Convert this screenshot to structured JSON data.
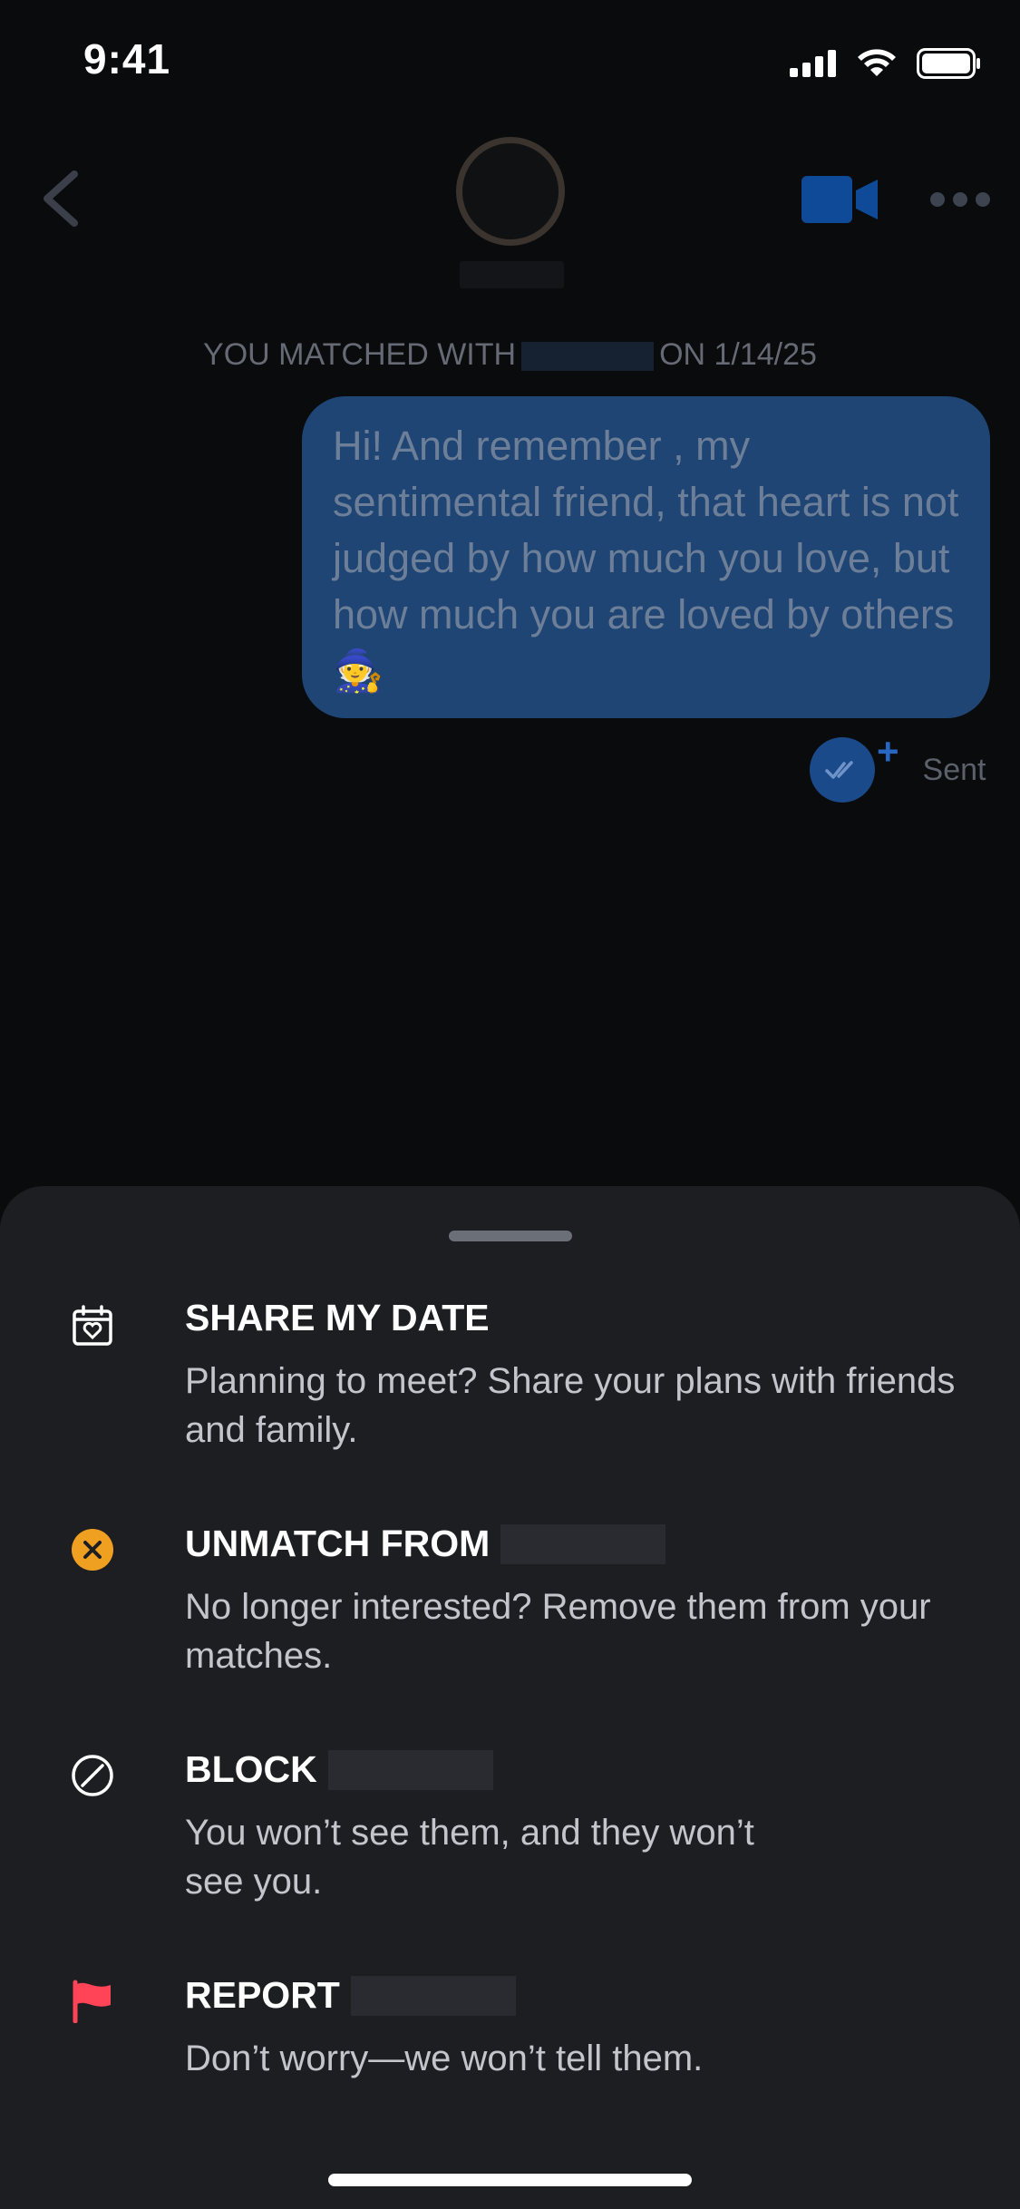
{
  "status_bar": {
    "time": "9:41"
  },
  "header": {
    "back_icon": "chevron-left-icon",
    "video_icon": "video-camera-icon",
    "more_icon": "more-dots-icon"
  },
  "chat": {
    "matched_prefix": "YOU MATCHED WITH",
    "matched_suffix": "ON 1/14/25",
    "message": "Hi! And remember , my sentimental friend, that heart is not judged by how much you love, but how much you are loved by others 🧙",
    "status": "Sent"
  },
  "sheet": {
    "options": [
      {
        "title": "SHARE MY DATE",
        "desc": "Planning to meet? Share your plans with friends and family.",
        "icon": "calendar-heart-icon"
      },
      {
        "title": "UNMATCH FROM",
        "desc": "No longer interested? Remove them from your matches.",
        "icon": "unmatch-x-icon"
      },
      {
        "title": "BLOCK",
        "desc": "You won’t see them, and they won’t see you.",
        "icon": "block-icon"
      },
      {
        "title": "REPORT",
        "desc": "Don’t worry—we won’t tell them.",
        "icon": "flag-icon"
      }
    ]
  },
  "colors": {
    "accent_blue": "#1f4574",
    "unmatch_orange": "#f0a020",
    "report_red": "#ff4458",
    "sheet_bg": "#1d1e22"
  }
}
